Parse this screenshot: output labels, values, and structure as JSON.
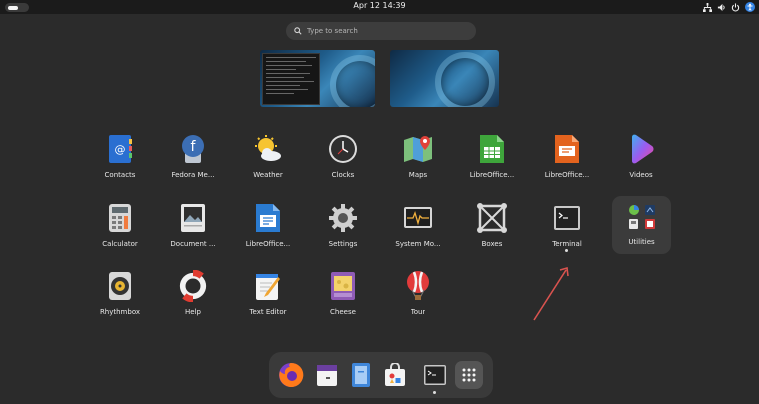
{
  "topbar": {
    "clock": "Apr 12  14:39",
    "icons": [
      "activities-indicator",
      "network-icon",
      "volume-icon",
      "power-icon",
      "accessibility-icon"
    ]
  },
  "search": {
    "placeholder": "Type to search"
  },
  "workspaces": [
    "workspace-1",
    "workspace-2"
  ],
  "apps": [
    {
      "label": "Contacts",
      "icon": "contacts-icon"
    },
    {
      "label": "Fedora Me...",
      "icon": "fedora-media-writer-icon"
    },
    {
      "label": "Weather",
      "icon": "weather-icon"
    },
    {
      "label": "Clocks",
      "icon": "clocks-icon"
    },
    {
      "label": "Maps",
      "icon": "maps-icon"
    },
    {
      "label": "LibreOffice...",
      "icon": "libreoffice-calc-icon"
    },
    {
      "label": "LibreOffice...",
      "icon": "libreoffice-impress-icon"
    },
    {
      "label": "Videos",
      "icon": "videos-icon"
    },
    {
      "label": "Calculator",
      "icon": "calculator-icon"
    },
    {
      "label": "Document ...",
      "icon": "document-viewer-icon"
    },
    {
      "label": "LibreOffice...",
      "icon": "libreoffice-writer-icon"
    },
    {
      "label": "Settings",
      "icon": "settings-icon"
    },
    {
      "label": "System Mo...",
      "icon": "system-monitor-icon"
    },
    {
      "label": "Boxes",
      "icon": "boxes-icon"
    },
    {
      "label": "Terminal",
      "icon": "terminal-icon"
    },
    {
      "label": "Utilities",
      "icon": "utilities-folder-icon"
    },
    {
      "label": "Rhythmbox",
      "icon": "rhythmbox-icon"
    },
    {
      "label": "Help",
      "icon": "help-icon"
    },
    {
      "label": "Text Editor",
      "icon": "text-editor-icon"
    },
    {
      "label": "Cheese",
      "icon": "cheese-icon"
    },
    {
      "label": "Tour",
      "icon": "tour-icon"
    }
  ],
  "dock": [
    "firefox-icon",
    "calendar-icon",
    "files-icon",
    "software-icon",
    "terminal-icon",
    "show-apps-icon"
  ],
  "colors": {
    "background": "#2b2b2b",
    "topbar": "#1b1b1b",
    "dock": "#3a3a3a",
    "arrow": "#d9534f"
  }
}
